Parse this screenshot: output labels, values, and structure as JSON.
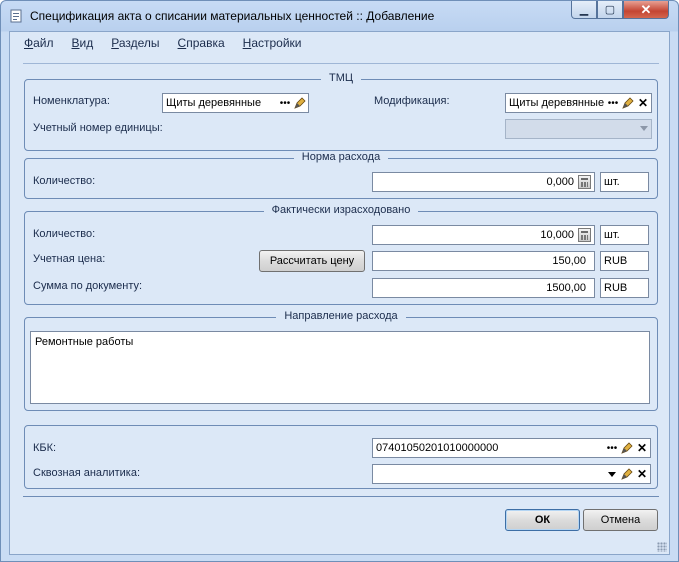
{
  "window": {
    "title": "Спецификация акта о списании материальных ценностей :: Добавление",
    "controls": {
      "minimize": "▁",
      "maximize": "▢",
      "close": "✕"
    }
  },
  "menu": {
    "items": [
      {
        "label": "Файл",
        "accel": "Ф",
        "rest": "айл"
      },
      {
        "label": "Вид",
        "accel": "В",
        "rest": "ид"
      },
      {
        "label": "Разделы",
        "accel": "Р",
        "rest": "азделы"
      },
      {
        "label": "Справка",
        "accel": "С",
        "rest": "правка"
      },
      {
        "label": "Настройки",
        "accel": "Н",
        "rest": "астройки"
      }
    ]
  },
  "tmc": {
    "title": "ТМЦ",
    "nomenclature_label": "Номенклатура:",
    "nomenclature_value": "Щиты деревянные",
    "modification_label": "Модификация:",
    "modification_value": "Щиты деревянные",
    "unit_number_label": "Учетный номер единицы:",
    "unit_number_value": ""
  },
  "norm": {
    "title": "Норма расхода",
    "quantity_label": "Количество:",
    "quantity_value": "0,000",
    "unit": "шт."
  },
  "actual": {
    "title": "Фактически израсходовано",
    "quantity_label": "Количество:",
    "quantity_value": "10,000",
    "quantity_unit": "шт.",
    "price_label": "Учетная цена:",
    "calc_button": "Рассчитать цену",
    "price_value": "150,00",
    "price_currency": "RUB",
    "sum_label": "Сумма по документу:",
    "sum_value": "1500,00",
    "sum_currency": "RUB"
  },
  "direction": {
    "title": "Направление расхода",
    "text": "Ремонтные работы"
  },
  "kbk": {
    "label": "КБК:",
    "value": "07401050201010000000",
    "analytics_label": "Сквозная аналитика:",
    "analytics_value": ""
  },
  "buttons": {
    "ok": "ОК",
    "cancel": "Отмена"
  }
}
